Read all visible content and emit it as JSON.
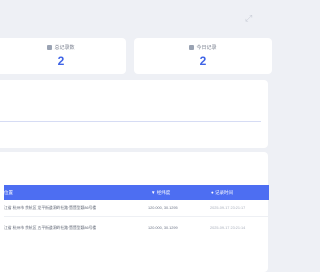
{
  "topbar": {
    "icon": "expand-icon"
  },
  "stats": [
    {
      "label": "总记录数",
      "value": "2",
      "icon": "record-icon"
    },
    {
      "label": "今日记录",
      "value": "2",
      "icon": "calendar-icon"
    }
  ],
  "table": {
    "headers": {
      "location": "位置",
      "coord": "经纬度",
      "time": "记录时间"
    },
    "rows": [
      {
        "location": "江省 杭州市 余杭区 龙平街道洞岭社路·暨暨型颖86号楼",
        "coord": "120.000, 30.1295",
        "time": "2025-09-17 23:21:17"
      },
      {
        "location": "江省 杭州市 余杭区 五平街道洞岭社路·暨暨型颖86号楼",
        "coord": "120.000, 30.1299",
        "time": "2025-09-17 23:21:14"
      }
    ]
  },
  "colors": {
    "accent": "#3f64e6",
    "header": "#4d6ef2"
  }
}
